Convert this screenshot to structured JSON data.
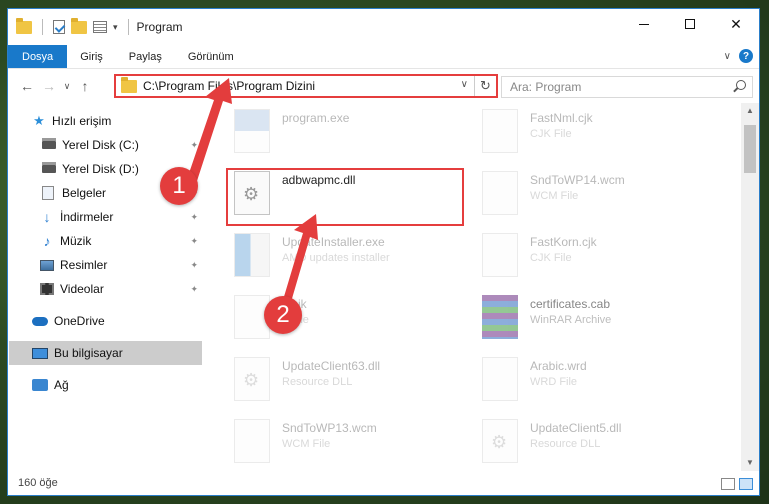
{
  "window": {
    "title": "Program",
    "controls": {
      "minimize": "–",
      "maximize": "□",
      "close": "✕"
    }
  },
  "ribbon": {
    "tabs": [
      "Dosya",
      "Giriş",
      "Paylaş",
      "Görünüm"
    ],
    "help": "?",
    "expand": "∨"
  },
  "navbar": {
    "back": "←",
    "forward": "→",
    "recent": "∨",
    "up": "↑",
    "address": "C:\\Program Files\\Program Dizini",
    "dropdown": "∨",
    "refresh": "↻",
    "search_placeholder": "Ara: Program"
  },
  "sidebar": {
    "items": [
      {
        "label": "Hızlı erişim",
        "icon": "star-icon",
        "pinned": false
      },
      {
        "label": "Yerel Disk (C:)",
        "icon": "disk-icon",
        "pinned": true
      },
      {
        "label": "Yerel Disk (D:)",
        "icon": "disk-icon",
        "pinned": true
      },
      {
        "label": "Belgeler",
        "icon": "documents-icon",
        "pinned": true
      },
      {
        "label": "İndirmeler",
        "icon": "downloads-icon",
        "pinned": true
      },
      {
        "label": "Müzik",
        "icon": "music-icon",
        "pinned": true
      },
      {
        "label": "Resimler",
        "icon": "pictures-icon",
        "pinned": true
      },
      {
        "label": "Videolar",
        "icon": "videos-icon",
        "pinned": true
      },
      {
        "label": "OneDrive",
        "icon": "onedrive-icon",
        "pinned": false
      },
      {
        "label": "Bu bilgisayar",
        "icon": "computer-icon",
        "pinned": false,
        "selected": true
      },
      {
        "label": "Ağ",
        "icon": "network-icon",
        "pinned": false
      }
    ],
    "pin_glyph": "📌"
  },
  "files": [
    {
      "name": "program.exe",
      "type": "",
      "icon": "exe-icon",
      "faded": true
    },
    {
      "name": "FastNml.cjk",
      "type": "CJK File",
      "icon": "file-icon",
      "faded": true
    },
    {
      "name": "adbwapmc.dll",
      "type": "",
      "icon": "dll-gear-icon",
      "faded": false,
      "highlighted": true
    },
    {
      "name": "SndToWP14.wcm",
      "type": "WCM File",
      "icon": "file-icon",
      "faded": true
    },
    {
      "name": "UpdateInstaller.exe",
      "type": "AMD updates installer",
      "icon": "installer-icon",
      "faded": true
    },
    {
      "name": "FastKorn.cjk",
      "type": "CJK File",
      "icon": "file-icon",
      "faded": true
    },
    {
      "name": "...cjk",
      "type": "...File",
      "icon": "file-icon",
      "faded": true
    },
    {
      "name": "certificates.cab",
      "type": "WinRAR Archive",
      "icon": "rar-icon",
      "faded": true
    },
    {
      "name": "UpdateClient63.dll",
      "type": "Resource DLL",
      "icon": "dll-gear-icon",
      "faded": true
    },
    {
      "name": "Arabic.wrd",
      "type": "WRD File",
      "icon": "file-icon",
      "faded": true
    },
    {
      "name": "SndToWP13.wcm",
      "type": "WCM File",
      "icon": "file-icon",
      "faded": true
    },
    {
      "name": "UpdateClient5.dll",
      "type": "Resource DLL",
      "icon": "dll-gear-icon",
      "faded": true
    }
  ],
  "status": {
    "count": "160 öğe"
  },
  "annotations": {
    "step1": "1",
    "step2": "2",
    "color": "#e33d3d"
  },
  "colors": {
    "accent": "#1979ca",
    "highlight": "#e53d3d"
  }
}
